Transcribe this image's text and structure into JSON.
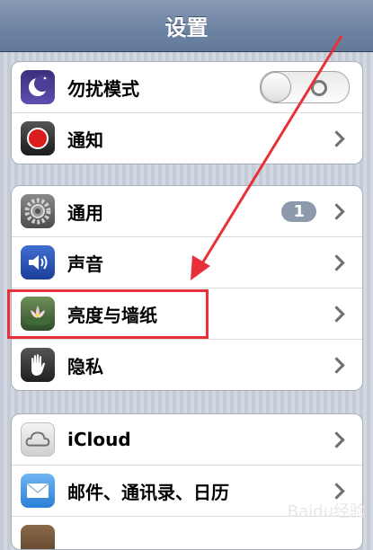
{
  "navbar": {
    "title": "设置"
  },
  "groups": [
    {
      "items": [
        {
          "label": "勿扰模式",
          "icon": "moon-icon",
          "control": "toggle",
          "toggle_state": "off"
        },
        {
          "label": "通知",
          "icon": "notification-icon",
          "control": "chevron"
        }
      ]
    },
    {
      "items": [
        {
          "label": "通用",
          "icon": "gear-icon",
          "control": "chevron",
          "badge": "1"
        },
        {
          "label": "声音",
          "icon": "speaker-icon",
          "control": "chevron"
        },
        {
          "label": "亮度与墙纸",
          "icon": "flower-icon",
          "control": "chevron"
        },
        {
          "label": "隐私",
          "icon": "hand-icon",
          "control": "chevron"
        }
      ]
    },
    {
      "items": [
        {
          "label": "iCloud",
          "icon": "cloud-icon",
          "control": "chevron"
        },
        {
          "label": "邮件、通讯录、日历",
          "icon": "mail-icon",
          "control": "chevron"
        }
      ]
    }
  ],
  "annotation": {
    "highlight_color": "#e8303a"
  },
  "watermark": "Baidu经验"
}
